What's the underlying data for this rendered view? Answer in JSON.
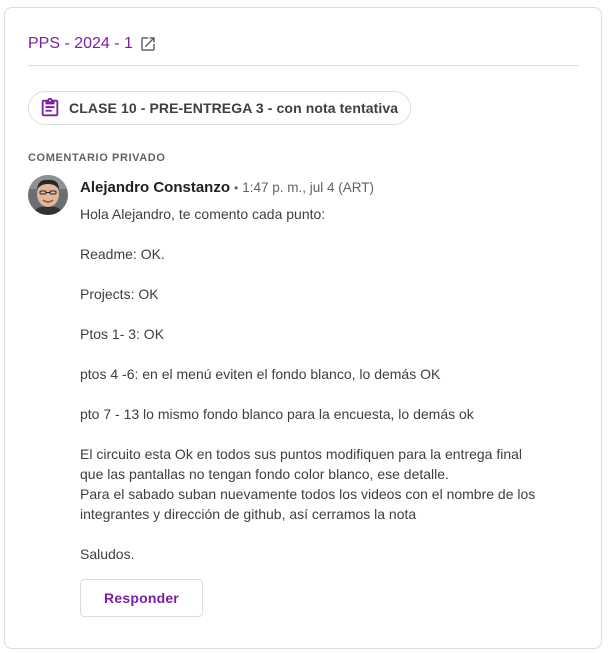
{
  "header": {
    "title": "PPS - 2024 - 1",
    "icon": "open-in-new-icon"
  },
  "assignment": {
    "label": "CLASE 10 - PRE-ENTREGA 3 - con nota tentativa",
    "icon": "assignment-icon"
  },
  "section": {
    "label": "COMENTARIO PRIVADO"
  },
  "comment": {
    "author": "Alejandro Constanzo",
    "separator": "•",
    "timestamp": "1:47 p. m., jul 4 (ART)",
    "lines": {
      "l0": "Hola Alejandro, te comento cada punto:",
      "l1": "Readme: OK.",
      "l2": "Projects: OK",
      "l3": "Ptos 1- 3: OK",
      "l4": "ptos 4 -6: en el menú eviten el fondo blanco, lo demás OK",
      "l5": "pto 7 - 13 lo mismo fondo blanco para la encuesta, lo demás ok",
      "l6": "El circuito esta Ok en todos sus puntos modifiquen para la entrega final",
      "l7": "que las pantallas no tengan fondo color blanco, ese detalle.",
      "l8": "Para el sabado suban nuevamente todos los videos con el nombre de los",
      "l9": "integrantes y dirección de github, así cerramos la nota",
      "l10": "Saludos."
    }
  },
  "actions": {
    "reply_label": "Responder"
  },
  "colors": {
    "accent": "#7b1fa2",
    "border": "#dadce0",
    "text": "#3c4043",
    "muted": "#5f6368"
  }
}
